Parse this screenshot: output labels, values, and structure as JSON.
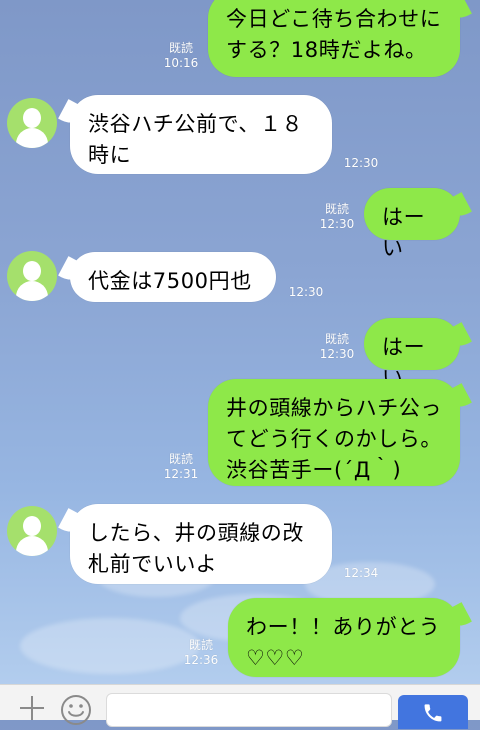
{
  "messages": [
    {
      "side": "right",
      "text": "今日どこ待ち合わせにする？18時だよね。",
      "read": "既読",
      "time": "10:16"
    },
    {
      "side": "left",
      "text": "渋谷ハチ公前で、１８時に",
      "time": "12:30"
    },
    {
      "side": "right",
      "text": "はーい",
      "read": "既読",
      "time": "12:30"
    },
    {
      "side": "left",
      "text": "代金は7500円也",
      "time": "12:30"
    },
    {
      "side": "right",
      "text": "はーい",
      "read": "既読",
      "time": "12:30"
    },
    {
      "side": "right",
      "text": "井の頭線からハチ公ってどう行くのかしら。渋谷苦手ー(´Д｀)",
      "read": "既読",
      "time": "12:31"
    },
    {
      "side": "left",
      "text": "したら、井の頭線の改札前でいいよ",
      "time": "12:34"
    },
    {
      "side": "right",
      "text": "わー！！ありがとう♡♡♡",
      "read": "既読",
      "time": "12:36"
    }
  ],
  "composer": {
    "plus_icon": "plus-icon",
    "emoji_icon": "smile-icon",
    "input_value": "",
    "send_icon": "phone-icon"
  },
  "colors": {
    "outgoing_bubble": "#8ee849",
    "incoming_bubble": "#ffffff",
    "send_button": "#4275df",
    "avatar": "#a5e06c"
  }
}
